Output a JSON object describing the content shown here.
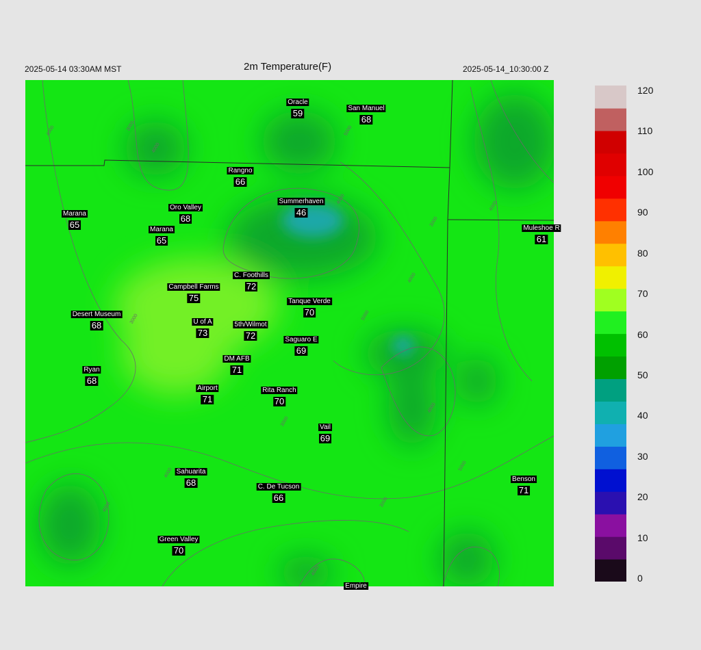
{
  "header": {
    "local_time": "2025-05-14 03:30AM MST",
    "title": "2m Temperature(F)",
    "utc_time": "2025-05-14_10:30:00 Z"
  },
  "colors": {
    "background": "#e5e5e5",
    "field_base": "#14e614",
    "warm_patch": "#73f028",
    "cool_patch": "#0fa82a",
    "cold_patch": "#1aa8a8",
    "boundary": "#2a2a2a",
    "contour": "#6a6a6a",
    "label_bg": "#000000",
    "label_text": "#ffffff"
  },
  "stations": [
    {
      "name": "Oracle",
      "value": "59"
    },
    {
      "name": "San Manuel",
      "value": "68"
    },
    {
      "name": "Rangno",
      "value": "66"
    },
    {
      "name": "Marana",
      "value": "65"
    },
    {
      "name": "Oro Valley",
      "value": "68"
    },
    {
      "name": "Marana",
      "value": "65"
    },
    {
      "name": "Summerhaven",
      "value": "46"
    },
    {
      "name": "Muleshoe R",
      "value": "61"
    },
    {
      "name": "C. Foothills",
      "value": "72"
    },
    {
      "name": "Campbell Farms",
      "value": "75"
    },
    {
      "name": "Tanque Verde",
      "value": "70"
    },
    {
      "name": "Desert Museum",
      "value": "68"
    },
    {
      "name": "U of A",
      "value": "73"
    },
    {
      "name": "5th/Wilmot",
      "value": "72"
    },
    {
      "name": "Saguaro E",
      "value": "69"
    },
    {
      "name": "DM AFB",
      "value": "71"
    },
    {
      "name": "Ryan",
      "value": "68"
    },
    {
      "name": "Airport",
      "value": "71"
    },
    {
      "name": "Rita Ranch",
      "value": "70"
    },
    {
      "name": "Vail",
      "value": "69"
    },
    {
      "name": "Sahuarita",
      "value": "68"
    },
    {
      "name": "C. De Tucson",
      "value": "66"
    },
    {
      "name": "Benson",
      "value": "71"
    },
    {
      "name": "Green Valley",
      "value": "70"
    },
    {
      "name": "Empire",
      "value": ""
    }
  ],
  "colorbar": {
    "ticks": [
      "120",
      "110",
      "100",
      "90",
      "80",
      "70",
      "60",
      "50",
      "40",
      "30",
      "20",
      "10",
      "0"
    ],
    "stops": [
      "#1a0a1a",
      "#5a0a6a",
      "#8a10a0",
      "#2a10b0",
      "#0010d0",
      "#1060e0",
      "#20a0e0",
      "#10b0b0",
      "#00a080",
      "#00a000",
      "#00c000",
      "#20f020",
      "#a0ff20",
      "#f0f000",
      "#ffc000",
      "#ff8000",
      "#ff3000",
      "#f00000",
      "#e00000",
      "#d00000",
      "#c06060",
      "#d8c8c8"
    ]
  },
  "contour_labels": [
    "4000",
    "3000",
    "4000",
    "5000",
    "4000",
    "4000",
    "3000",
    "4000",
    "3000",
    "5000",
    "4000",
    "3000",
    "4000",
    "4000",
    "3000",
    "5000",
    "4000"
  ]
}
